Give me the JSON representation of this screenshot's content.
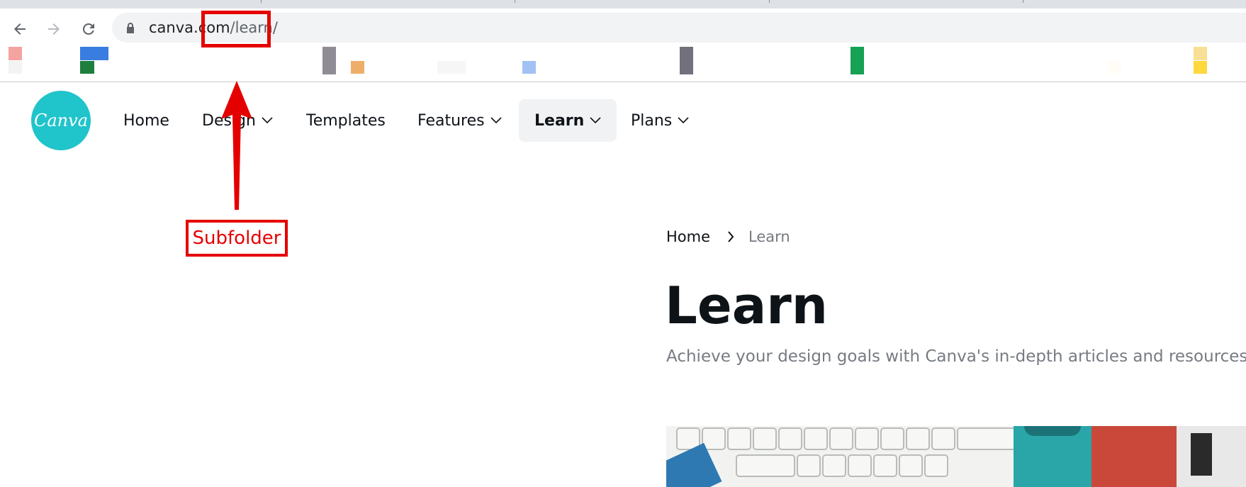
{
  "browser": {
    "back_icon": "arrow-left-icon",
    "forward_icon": "arrow-right-icon",
    "reload_icon": "reload-icon",
    "lock_icon": "lock-icon",
    "url_host": "canva.com",
    "url_path": "/learn/"
  },
  "site": {
    "logo_text": "Canva",
    "nav": {
      "home": "Home",
      "design": "Design",
      "templates": "Templates",
      "features": "Features",
      "learn": "Learn",
      "plans": "Plans"
    }
  },
  "page": {
    "breadcrumb_home": "Home",
    "breadcrumb_current": "Learn",
    "title": "Learn",
    "subtitle": "Achieve your design goals with Canva's in-depth articles and resources."
  },
  "annotation": {
    "label": "Subfolder"
  },
  "colors": {
    "brand": "#20c4cb",
    "annotation": "#e50000",
    "text": "#0e1318",
    "muted": "#767b82"
  }
}
